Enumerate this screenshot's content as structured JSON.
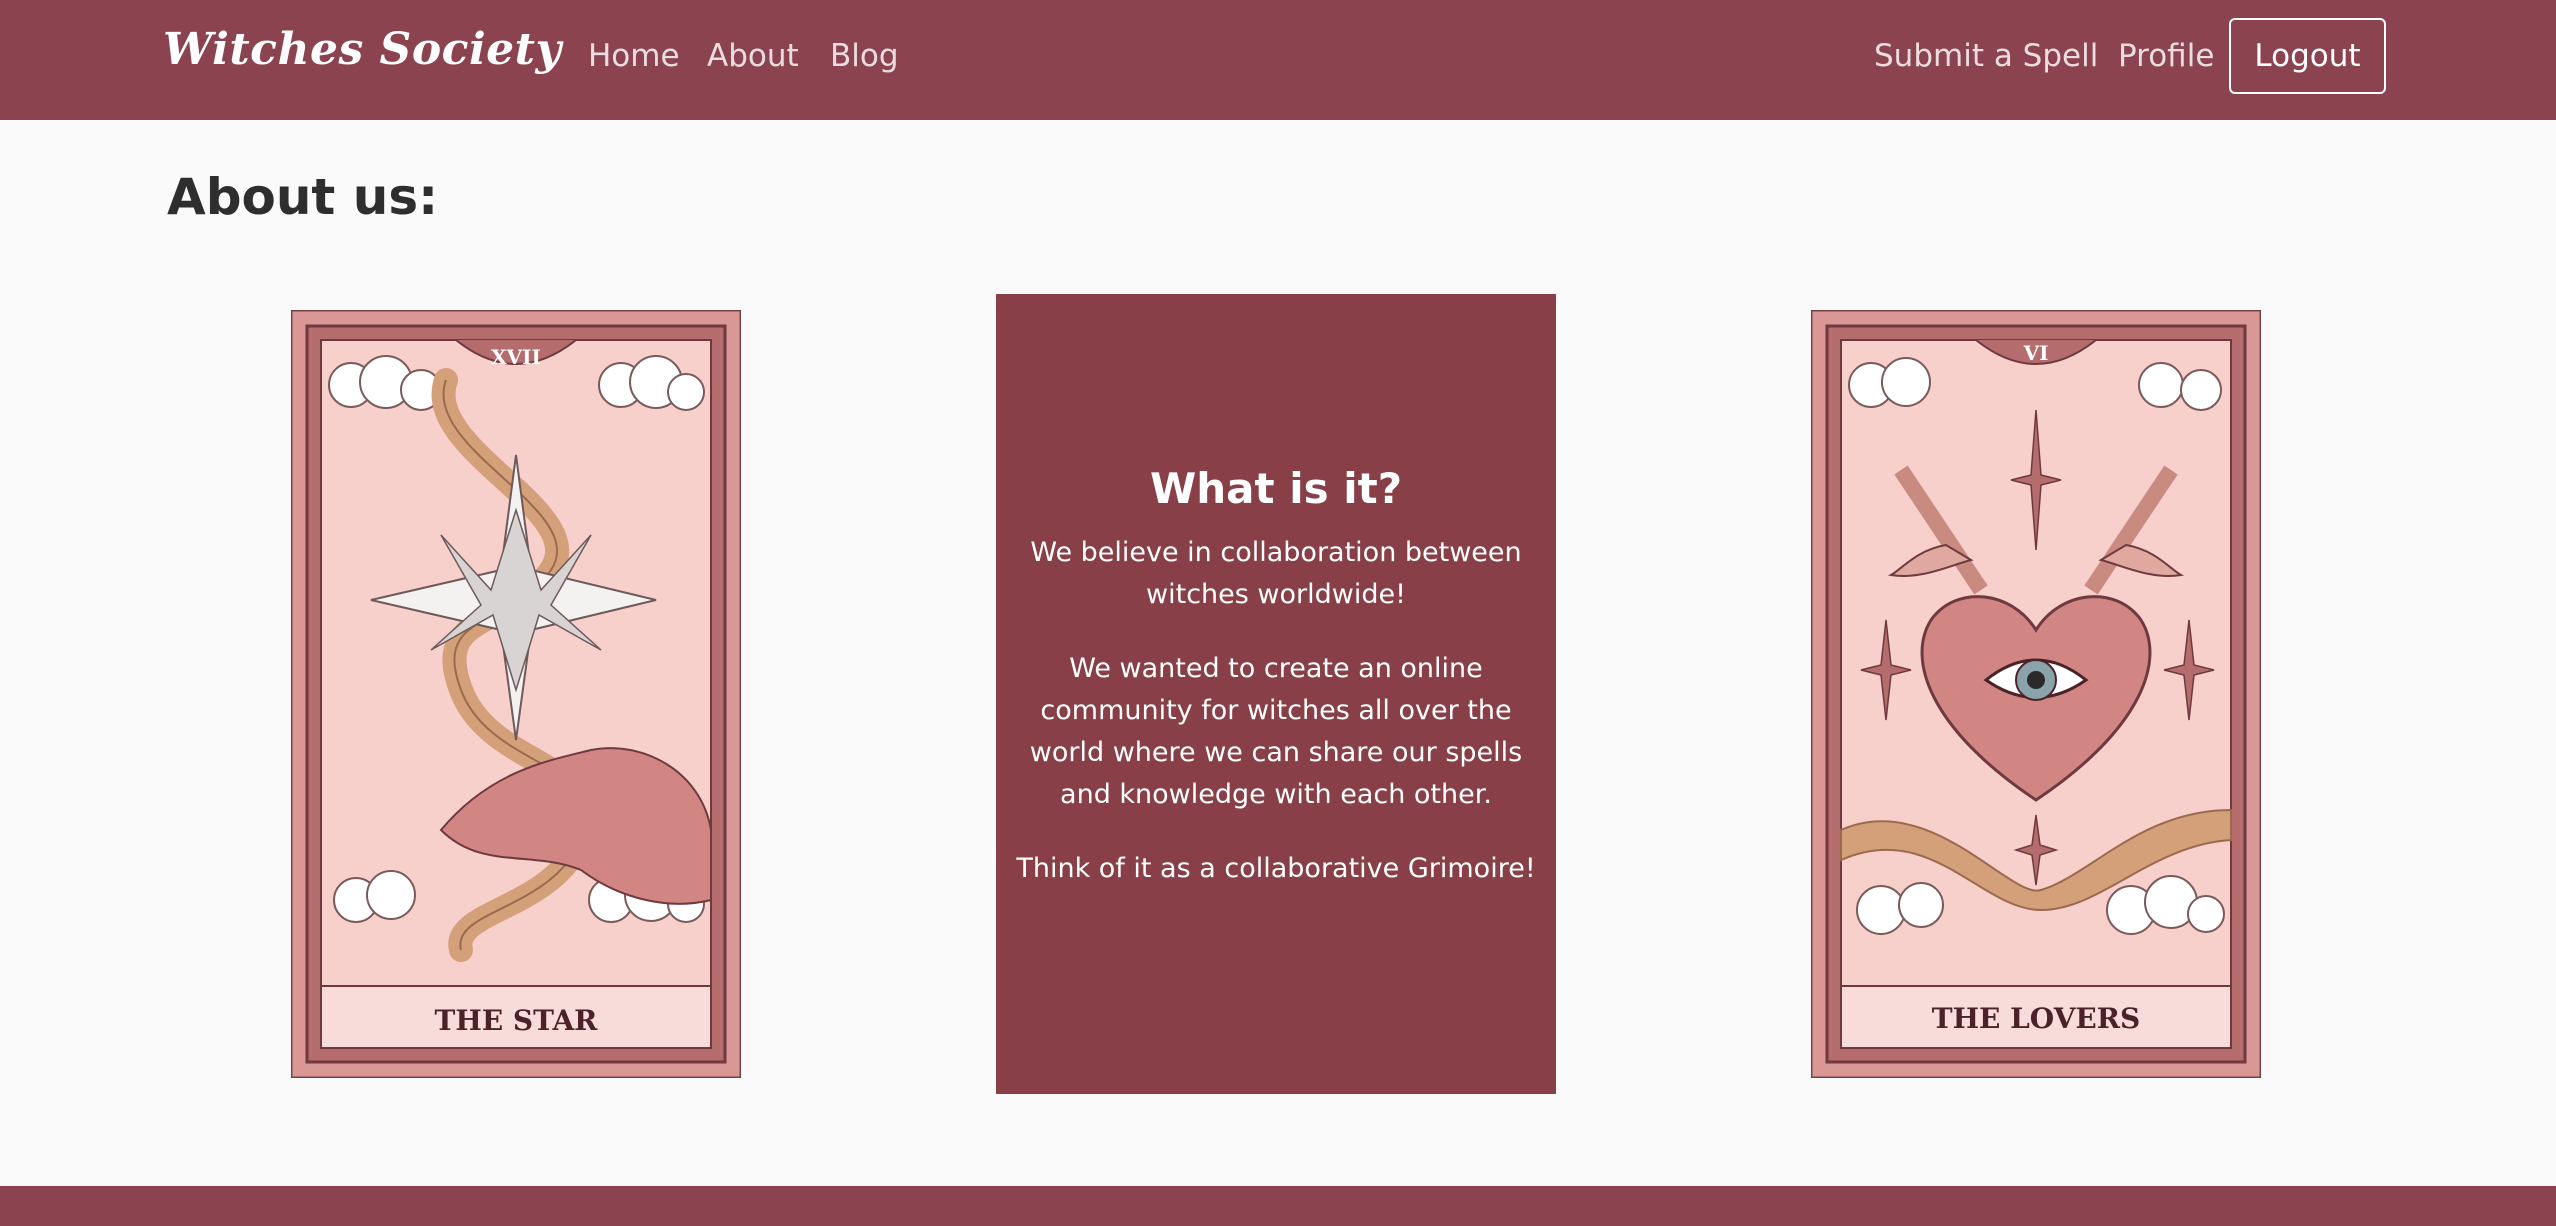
{
  "navbar": {
    "brand": "Witches Society",
    "links": {
      "home": "Home",
      "about": "About",
      "blog": "Blog",
      "submit_spell": "Submit a Spell",
      "profile": "Profile"
    },
    "logout_label": "Logout"
  },
  "page": {
    "title": "About us:"
  },
  "cards": {
    "left": {
      "numeral": "XVII",
      "name": "THE STAR"
    },
    "right": {
      "numeral": "VI",
      "name": "THE LOVERS"
    }
  },
  "info": {
    "title": "What is it?",
    "p1": "We believe in collaboration between witches worldwide!",
    "p2": "We wanted to create an online community for witches all over the world where we can share our spells and knowledge with each other.",
    "p3": "Think of it as a collaborative Grimoire!"
  },
  "colors": {
    "brand": "#8c4350",
    "info_box": "#883f47",
    "card_border": "#d28f8f",
    "card_bg": "#f6cfcc"
  }
}
